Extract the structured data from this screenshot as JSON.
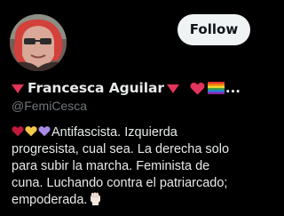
{
  "profile": {
    "name": "Francesca Aguilar",
    "handle": "@FemiCesca",
    "name_ellipsis": "...",
    "follow_label": "Follow",
    "bio_lines": [
      "Antifascista. Izquierda",
      "progresista, cual sea. La derecha solo",
      "para subir la marcha. Feminista de",
      "cuna. Luchando contra el patriarcado;",
      "empoderada."
    ]
  },
  "icons": {
    "name_prefix": "red-triangle-down-icon",
    "name_suffix": "red-triangle-down-icon",
    "heart": "red-heart-icon",
    "flag": "rainbow-flag-icon",
    "bio_hearts": [
      "red-heart-icon",
      "yellow-heart-icon",
      "purple-heart-icon"
    ],
    "bio_end": "raised-fist-icon"
  },
  "colors": {
    "background": "#000000",
    "text": "#e7e9ea",
    "muted": "#71767b",
    "button_bg": "#eff3f4",
    "button_text": "#0f1419",
    "red": "#e2335a",
    "yellow": "#f7c948",
    "purple": "#a98be6"
  }
}
